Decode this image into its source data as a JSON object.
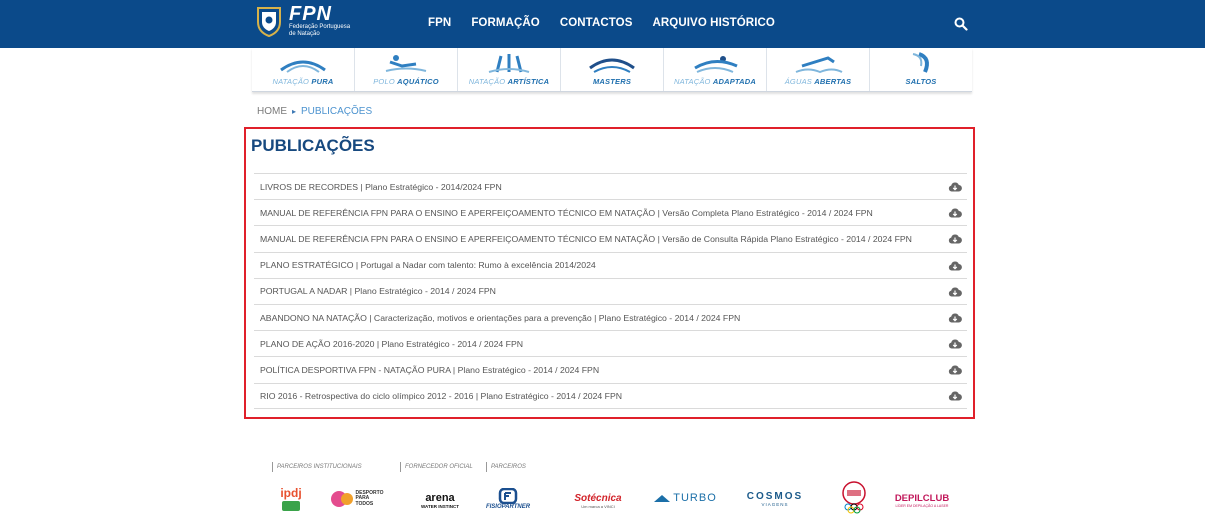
{
  "header": {
    "logo_text": "FPN",
    "logo_sub1": "Federação Portuguesa",
    "logo_sub2": "de Natação",
    "nav": [
      "FPN",
      "FORMAÇÃO",
      "CONTACTOS",
      "ARQUIVO HISTÓRICO"
    ],
    "search_icon": "search-icon",
    "bg_color": "#0b4a8a"
  },
  "disciplines": [
    {
      "light": "NATAÇÃO",
      "bold": "PURA"
    },
    {
      "light": "POLO",
      "bold": "AQUÁTICO"
    },
    {
      "light": "NATAÇÃO",
      "bold": "ARTÍSTICA"
    },
    {
      "light": "",
      "bold": "MASTERS"
    },
    {
      "light": "NATAÇÃO",
      "bold": "ADAPTADA"
    },
    {
      "light": "ÁGUAS",
      "bold": "ABERTAS"
    },
    {
      "light": "",
      "bold": "SALTOS"
    }
  ],
  "breadcrumb": {
    "home": "HOME",
    "sep": "▸",
    "current": "PUBLICAÇÕES"
  },
  "page": {
    "title": "PUBLICAÇÕES",
    "highlight_color": "#e0202a"
  },
  "publications": [
    "LIVROS DE RECORDES | Plano Estratégico - 2014/2024 FPN",
    "MANUAL DE REFERÊNCIA FPN PARA O ENSINO E APERFEIÇOAMENTO TÉCNICO EM NATAÇÃO | Versão Completa Plano Estratégico - 2014 / 2024 FPN",
    "MANUAL DE REFERÊNCIA FPN PARA O ENSINO E APERFEIÇOAMENTO TÉCNICO EM NATAÇÃO | Versão de Consulta Rápida Plano Estratégico - 2014 / 2024 FPN",
    "PLANO ESTRATÉGICO | Portugal a Nadar com talento: Rumo à excelência 2014/2024",
    "PORTUGAL A NADAR | Plano Estratégico - 2014 / 2024 FPN",
    "ABANDONO NA NATAÇÃO | Caracterização, motivos e orientações para a prevenção | Plano Estratégico - 2014 / 2024 FPN",
    "PLANO DE AÇÃO 2016-2020 | Plano Estratégico - 2014 / 2024 FPN",
    "POLÍTICA DESPORTIVA FPN - NATAÇÃO PURA | Plano Estratégico - 2014 / 2024 FPN",
    "RIO 2016 - Retrospectiva do ciclo olímpico 2012 - 2016 | Plano Estratégico - 2014 / 2024 FPN"
  ],
  "footer": {
    "groups": [
      "PARCEIROS INSTITUCIONAIS",
      "FORNECEDOR OFICIAL",
      "PARCEIROS"
    ],
    "logos": {
      "ipdj": "ipdj",
      "desporto": "DESPORTO PARA TODOS",
      "arena": "arena",
      "arena_sub": "WATER INSTINCT",
      "fisio": "FISIOPARTNER",
      "sotecnica": "Sotécnica",
      "sotecnica_sub": "Um marca a VINCI",
      "turbo": "TURBO",
      "cosmos": "COSMOS",
      "cosmos_sub": "VIAGENS",
      "depil": "DEPILCLUB",
      "depil_sub": "LÍDER EM DEPILAÇÃO A LASER"
    }
  }
}
